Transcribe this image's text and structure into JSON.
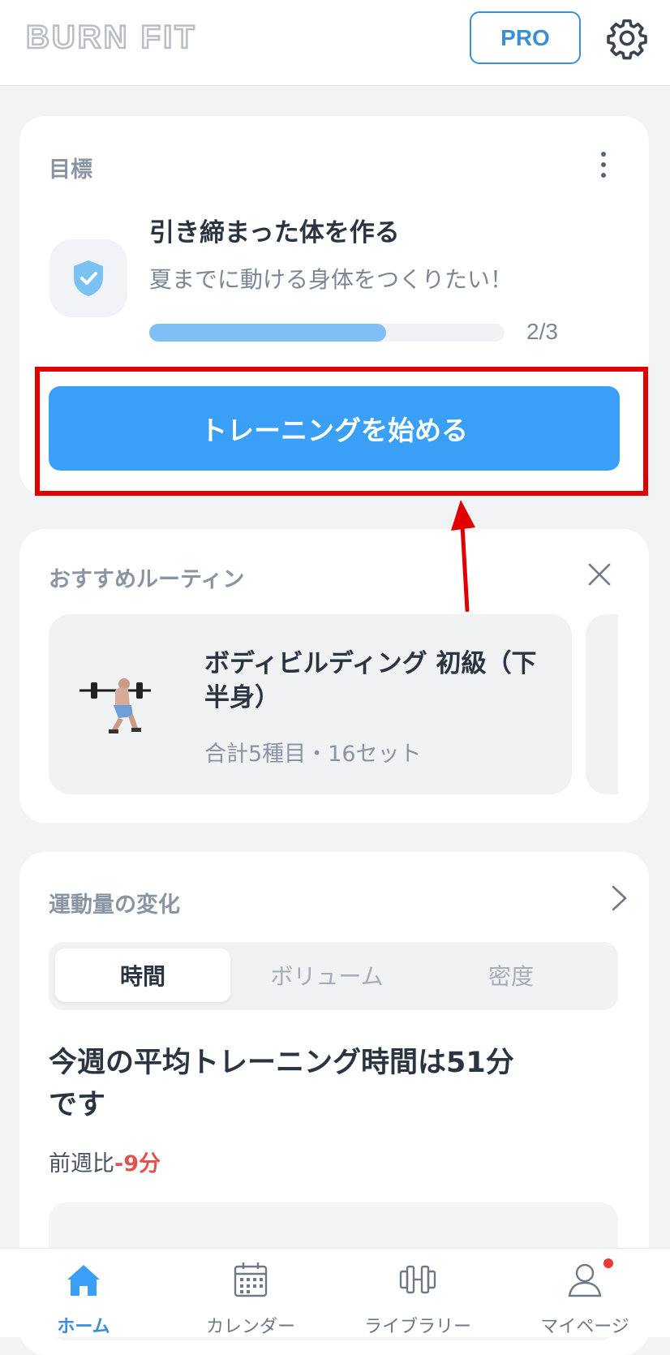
{
  "header": {
    "logo": "BURN FIT",
    "pro_label": "PRO",
    "settings_icon": "gear-icon"
  },
  "goal": {
    "section_label": "目標",
    "title": "引き締まった体を作る",
    "subtitle": "夏までに動ける身体をつくりたい！",
    "progress": 0.667,
    "progress_text": "2/3",
    "start_button": "トレーニングを始める",
    "icon": "shield-check-icon"
  },
  "routine": {
    "section_label": "おすすめルーティン",
    "title": "ボディビルディング 初級（下半身）",
    "meta": "合計5種目・16セット"
  },
  "volume": {
    "section_label": "運動量の変化",
    "tabs": [
      "時間",
      "ボリューム",
      "密度"
    ],
    "active_tab": 0,
    "headline": "今週の平均トレーニング時間は51分です",
    "compare_prefix": "前週比",
    "compare_value": "-9分"
  },
  "tabbar": {
    "items": [
      {
        "label": "ホーム",
        "icon": "home-icon",
        "active": true
      },
      {
        "label": "カレンダー",
        "icon": "calendar-icon",
        "active": false
      },
      {
        "label": "ライブラリー",
        "icon": "dumbbell-icon",
        "active": false
      },
      {
        "label": "マイページ",
        "icon": "user-icon",
        "active": false,
        "badge": true
      }
    ]
  },
  "colors": {
    "accent": "#3aa0f7",
    "highlight": "#e00000",
    "negative": "#e0534f"
  }
}
